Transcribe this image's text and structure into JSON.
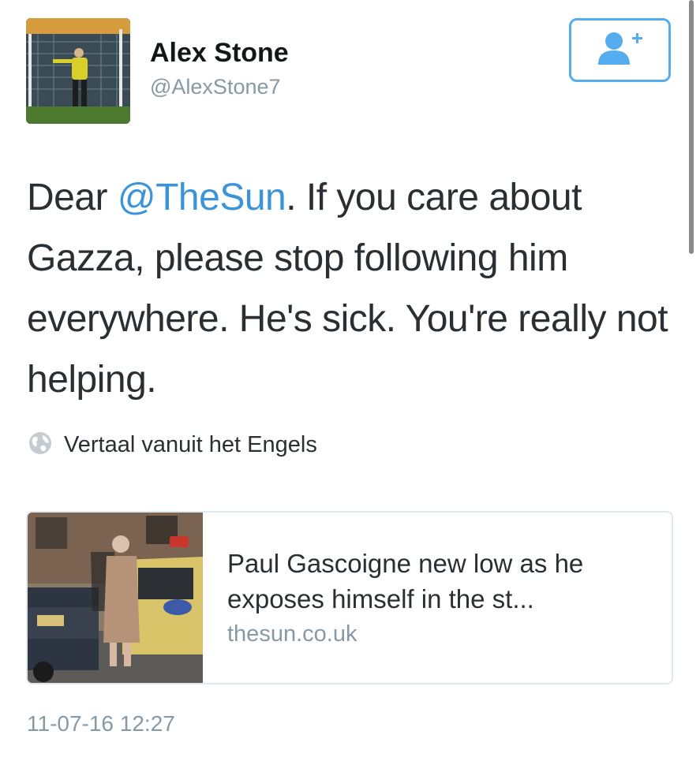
{
  "user": {
    "display_name": "Alex Stone",
    "handle": "@AlexStone7"
  },
  "follow_button": {
    "icon": "person-add-icon"
  },
  "tweet": {
    "text_before": "Dear ",
    "mention": "@TheSun",
    "text_after": ". If you care about Gazza, please stop following him everywhere. He's sick. You're really not helping."
  },
  "translate": {
    "icon": "globe-icon",
    "label": "Vertaal vanuit het Engels"
  },
  "link_card": {
    "title": "Paul Gascoigne new low as he exposes himself in the st...",
    "domain": "thesun.co.uk"
  },
  "timestamp": "11-07-16 12:27",
  "colors": {
    "link": "#3b94d9",
    "accent": "#55acee",
    "secondary_text": "#8899a6",
    "border": "#e1e8ed"
  }
}
